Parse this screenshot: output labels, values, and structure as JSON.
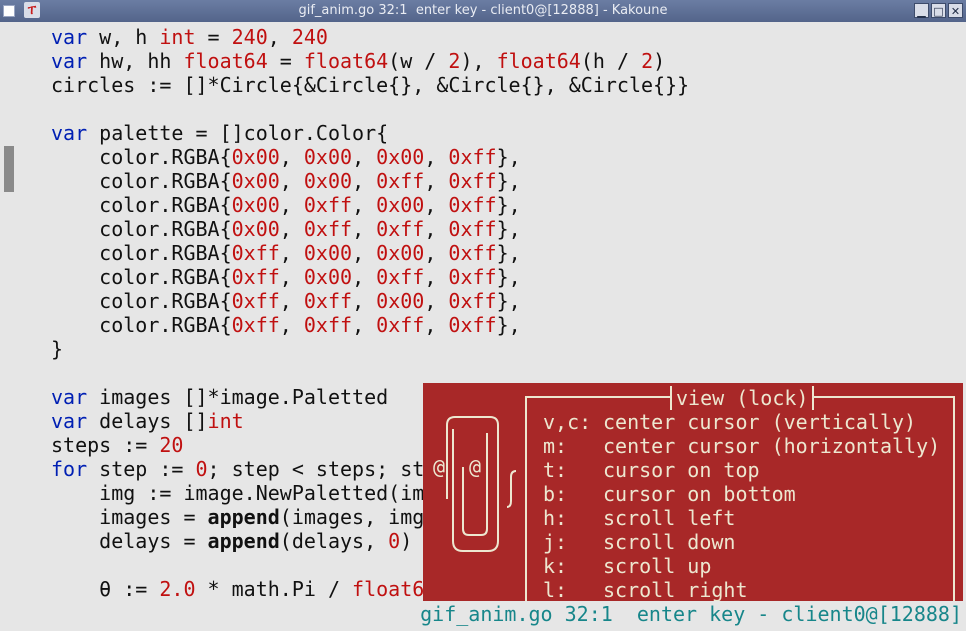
{
  "window": {
    "title": "gif_anim.go 32:1  enter key - client0@[12888] - Kakoune",
    "app_icon": "kakoune-logo-icon",
    "buttons": [
      "minimize-button",
      "maximize-button",
      "close-button"
    ]
  },
  "editor": {
    "lines": [
      [
        {
          "t": "var",
          "c": "kw"
        },
        {
          "t": " w, h "
        },
        {
          "t": "int",
          "c": "ty"
        },
        {
          "t": " = "
        },
        {
          "t": "240",
          "c": "num"
        },
        {
          "t": ", "
        },
        {
          "t": "240",
          "c": "num"
        }
      ],
      [
        {
          "t": "var",
          "c": "kw"
        },
        {
          "t": " hw, hh "
        },
        {
          "t": "float64",
          "c": "ty"
        },
        {
          "t": " = "
        },
        {
          "t": "float64",
          "c": "ty"
        },
        {
          "t": "(w / "
        },
        {
          "t": "2",
          "c": "num"
        },
        {
          "t": "), "
        },
        {
          "t": "float64",
          "c": "ty"
        },
        {
          "t": "(h / "
        },
        {
          "t": "2",
          "c": "num"
        },
        {
          "t": ")"
        }
      ],
      [
        {
          "t": "circles := []*Circle{&Circle{}, &Circle{}, &Circle{}}"
        }
      ],
      [
        {
          "t": ""
        }
      ],
      [
        {
          "t": "var",
          "c": "kw"
        },
        {
          "t": " palette = []color.Color{"
        }
      ],
      [
        {
          "t": "    color.RGBA{"
        },
        {
          "t": "0x00",
          "c": "num"
        },
        {
          "t": ", "
        },
        {
          "t": "0x00",
          "c": "num"
        },
        {
          "t": ", "
        },
        {
          "t": "0x00",
          "c": "num"
        },
        {
          "t": ", "
        },
        {
          "t": "0xff",
          "c": "num"
        },
        {
          "t": "},"
        }
      ],
      [
        {
          "t": "    color.RGBA{"
        },
        {
          "t": "0x00",
          "c": "num"
        },
        {
          "t": ", "
        },
        {
          "t": "0x00",
          "c": "num"
        },
        {
          "t": ", "
        },
        {
          "t": "0xff",
          "c": "num"
        },
        {
          "t": ", "
        },
        {
          "t": "0xff",
          "c": "num"
        },
        {
          "t": "},"
        }
      ],
      [
        {
          "t": "    color.RGBA{"
        },
        {
          "t": "0x00",
          "c": "num"
        },
        {
          "t": ", "
        },
        {
          "t": "0xff",
          "c": "num"
        },
        {
          "t": ", "
        },
        {
          "t": "0x00",
          "c": "num"
        },
        {
          "t": ", "
        },
        {
          "t": "0xff",
          "c": "num"
        },
        {
          "t": "},"
        }
      ],
      [
        {
          "t": "    color.RGBA{"
        },
        {
          "t": "0x00",
          "c": "num"
        },
        {
          "t": ", "
        },
        {
          "t": "0xff",
          "c": "num"
        },
        {
          "t": ", "
        },
        {
          "t": "0xff",
          "c": "num"
        },
        {
          "t": ", "
        },
        {
          "t": "0xff",
          "c": "num"
        },
        {
          "t": "},"
        }
      ],
      [
        {
          "t": "    color.RGBA{"
        },
        {
          "t": "0xff",
          "c": "num"
        },
        {
          "t": ", "
        },
        {
          "t": "0x00",
          "c": "num"
        },
        {
          "t": ", "
        },
        {
          "t": "0x00",
          "c": "num"
        },
        {
          "t": ", "
        },
        {
          "t": "0xff",
          "c": "num"
        },
        {
          "t": "},"
        }
      ],
      [
        {
          "t": "    color.RGBA{"
        },
        {
          "t": "0xff",
          "c": "num"
        },
        {
          "t": ", "
        },
        {
          "t": "0x00",
          "c": "num"
        },
        {
          "t": ", "
        },
        {
          "t": "0xff",
          "c": "num"
        },
        {
          "t": ", "
        },
        {
          "t": "0xff",
          "c": "num"
        },
        {
          "t": "},"
        }
      ],
      [
        {
          "t": "    color.RGBA{"
        },
        {
          "t": "0xff",
          "c": "num"
        },
        {
          "t": ", "
        },
        {
          "t": "0xff",
          "c": "num"
        },
        {
          "t": ", "
        },
        {
          "t": "0x00",
          "c": "num"
        },
        {
          "t": ", "
        },
        {
          "t": "0xff",
          "c": "num"
        },
        {
          "t": "},"
        }
      ],
      [
        {
          "t": "    color.RGBA{"
        },
        {
          "t": "0xff",
          "c": "num"
        },
        {
          "t": ", "
        },
        {
          "t": "0xff",
          "c": "num"
        },
        {
          "t": ", "
        },
        {
          "t": "0xff",
          "c": "num"
        },
        {
          "t": ", "
        },
        {
          "t": "0xff",
          "c": "num"
        },
        {
          "t": "},"
        }
      ],
      [
        {
          "t": "}"
        }
      ],
      [
        {
          "t": ""
        }
      ],
      [
        {
          "t": "var",
          "c": "kw"
        },
        {
          "t": " images []*image.Paletted"
        }
      ],
      [
        {
          "t": "var",
          "c": "kw"
        },
        {
          "t": " delays []"
        },
        {
          "t": "int",
          "c": "ty"
        }
      ],
      [
        {
          "t": "steps := "
        },
        {
          "t": "20",
          "c": "num"
        }
      ],
      [
        {
          "t": "for",
          "c": "kw"
        },
        {
          "t": " step := "
        },
        {
          "t": "0",
          "c": "num"
        },
        {
          "t": "; step < steps; st"
        }
      ],
      [
        {
          "t": "    img := image.NewPaletted(im"
        }
      ],
      [
        {
          "t": "    images = "
        },
        {
          "t": "append",
          "c": "bi"
        },
        {
          "t": "(images, img"
        }
      ],
      [
        {
          "t": "    delays = "
        },
        {
          "t": "append",
          "c": "bi"
        },
        {
          "t": "(delays, "
        },
        {
          "t": "0",
          "c": "num"
        },
        {
          "t": ")"
        }
      ],
      [
        {
          "t": ""
        }
      ],
      [
        {
          "t": "    θ := "
        },
        {
          "t": "2.0",
          "c": "num"
        },
        {
          "t": " * math.Pi / "
        },
        {
          "t": "float6",
          "c": "ty"
        }
      ]
    ]
  },
  "popup": {
    "title": "view (lock)",
    "clippy_icon": "clippy-paperclip-icon",
    "items": [
      {
        "key": "v,c:",
        "desc": "center cursor (vertically)"
      },
      {
        "key": "m:",
        "desc": "center cursor (horizontally)"
      },
      {
        "key": "t:",
        "desc": "cursor on top"
      },
      {
        "key": "b:",
        "desc": "cursor on bottom"
      },
      {
        "key": "h:",
        "desc": "scroll left"
      },
      {
        "key": "j:",
        "desc": "scroll down"
      },
      {
        "key": "k:",
        "desc": "scroll up"
      },
      {
        "key": "l:",
        "desc": "scroll right"
      }
    ],
    "clippy_eyes": "@ @"
  },
  "status": {
    "text": "gif_anim.go 32:1  enter key - client0@[12888]"
  },
  "colors": {
    "background": "#e6e6e6",
    "keyword": "#001fb3",
    "type_number": "#c01010",
    "popup_bg": "#a82828",
    "popup_fg": "#ede7d0",
    "status": "#17868a"
  }
}
